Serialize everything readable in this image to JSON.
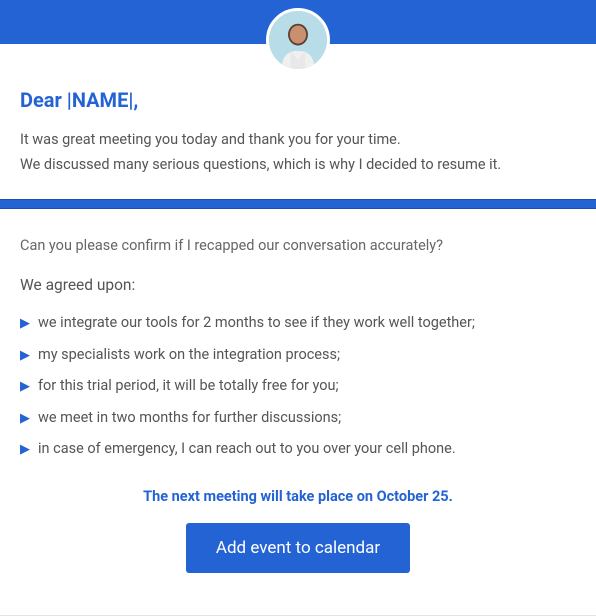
{
  "greeting": "Dear |NAME|,",
  "intro": {
    "line1": "It was great meeting you today and thank you for your time.",
    "line2": "We discussed many serious questions, which is why I decided to resume it."
  },
  "confirm_question": "Can you please confirm if I recapped our conversation accurately?",
  "agreed_title": "We agreed upon:",
  "bullets": [
    "we integrate our tools for 2 months to see if they work well together;",
    "my specialists work on the integration process;",
    "for this trial period, it will be totally free for you;",
    "we meet in two months for further discussions;",
    "in case of emergency, I can reach out to you over your cell phone."
  ],
  "next_meeting": "The next meeting will take place on October 25.",
  "cta_label": "Add event to calendar",
  "colors": {
    "accent": "#2463d4"
  }
}
